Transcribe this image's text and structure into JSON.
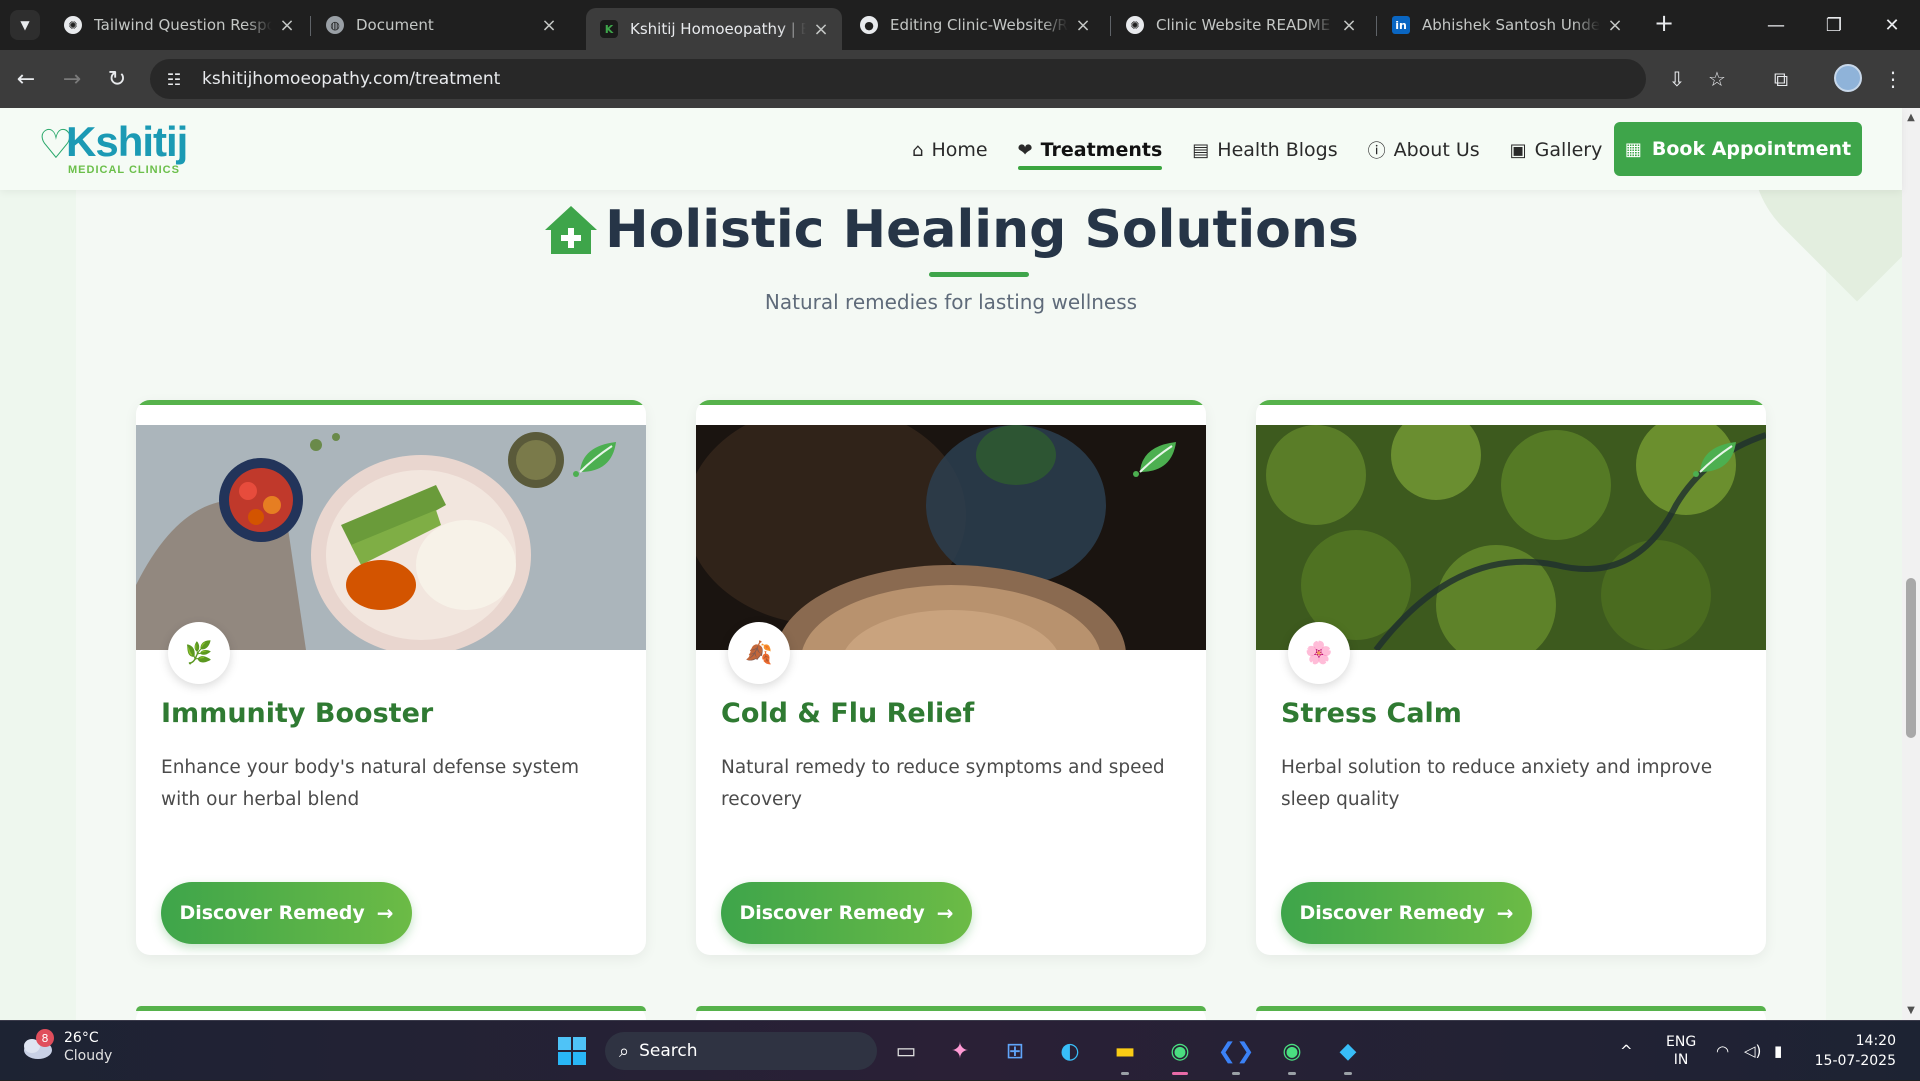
{
  "browser": {
    "tabs": [
      {
        "title": "Tailwind Question Respons",
        "icon": "openai-icon",
        "active": false
      },
      {
        "title": "Document",
        "icon": "globe-icon",
        "active": false
      },
      {
        "title": "Kshitij Homoeopathy | Best",
        "icon": "kshitij-favicon",
        "active": true
      },
      {
        "title": "Editing Clinic-Website/REA",
        "icon": "github-icon",
        "active": false
      },
      {
        "title": "Clinic Website README Gu",
        "icon": "openai-icon",
        "active": false
      },
      {
        "title": "Abhishek Santosh Unde | L",
        "icon": "linkedin-icon",
        "active": false
      }
    ],
    "url": "kshitijhomoeopathy.com/treatment"
  },
  "site": {
    "logo": {
      "word": "Kshitij",
      "sub": "MEDICAL CLINICS"
    },
    "nav": [
      {
        "label": "Home",
        "icon": "home-icon",
        "active": false
      },
      {
        "label": "Treatments",
        "icon": "heart-icon",
        "active": true
      },
      {
        "label": "Health Blogs",
        "icon": "document-icon",
        "active": false
      },
      {
        "label": "About Us",
        "icon": "info-icon",
        "active": false
      },
      {
        "label": "Gallery",
        "icon": "gallery-icon",
        "active": false
      }
    ],
    "book_label": "Book Appointment"
  },
  "section": {
    "title": "Holistic Healing Solutions",
    "subtitle": "Natural remedies for lasting wellness",
    "cards": [
      {
        "title": "Immunity Booster",
        "description": "Enhance your body's natural defense system with our herbal blend",
        "cta": "Discover Remedy",
        "badge_icon": "herb-icon"
      },
      {
        "title": "Cold & Flu Relief",
        "description": "Natural remedy to reduce symptoms and speed recovery",
        "cta": "Discover Remedy",
        "badge_icon": "leaf-icon"
      },
      {
        "title": "Stress Calm",
        "description": "Herbal solution to reduce anxiety and improve sleep quality",
        "cta": "Discover Remedy",
        "badge_icon": "flower-icon"
      }
    ]
  },
  "taskbar": {
    "weather_temp": "26°C",
    "weather_cond": "Cloudy",
    "weather_badge": "8",
    "search_label": "Search",
    "lang_top": "ENG",
    "lang_bottom": "IN",
    "time": "14:20",
    "date": "15-07-2025"
  },
  "colors": {
    "brand_green": "#3ea54a",
    "heading_dark": "#263547",
    "card_title_green": "#2f7a32",
    "logo_teal": "#1b9ab4"
  }
}
